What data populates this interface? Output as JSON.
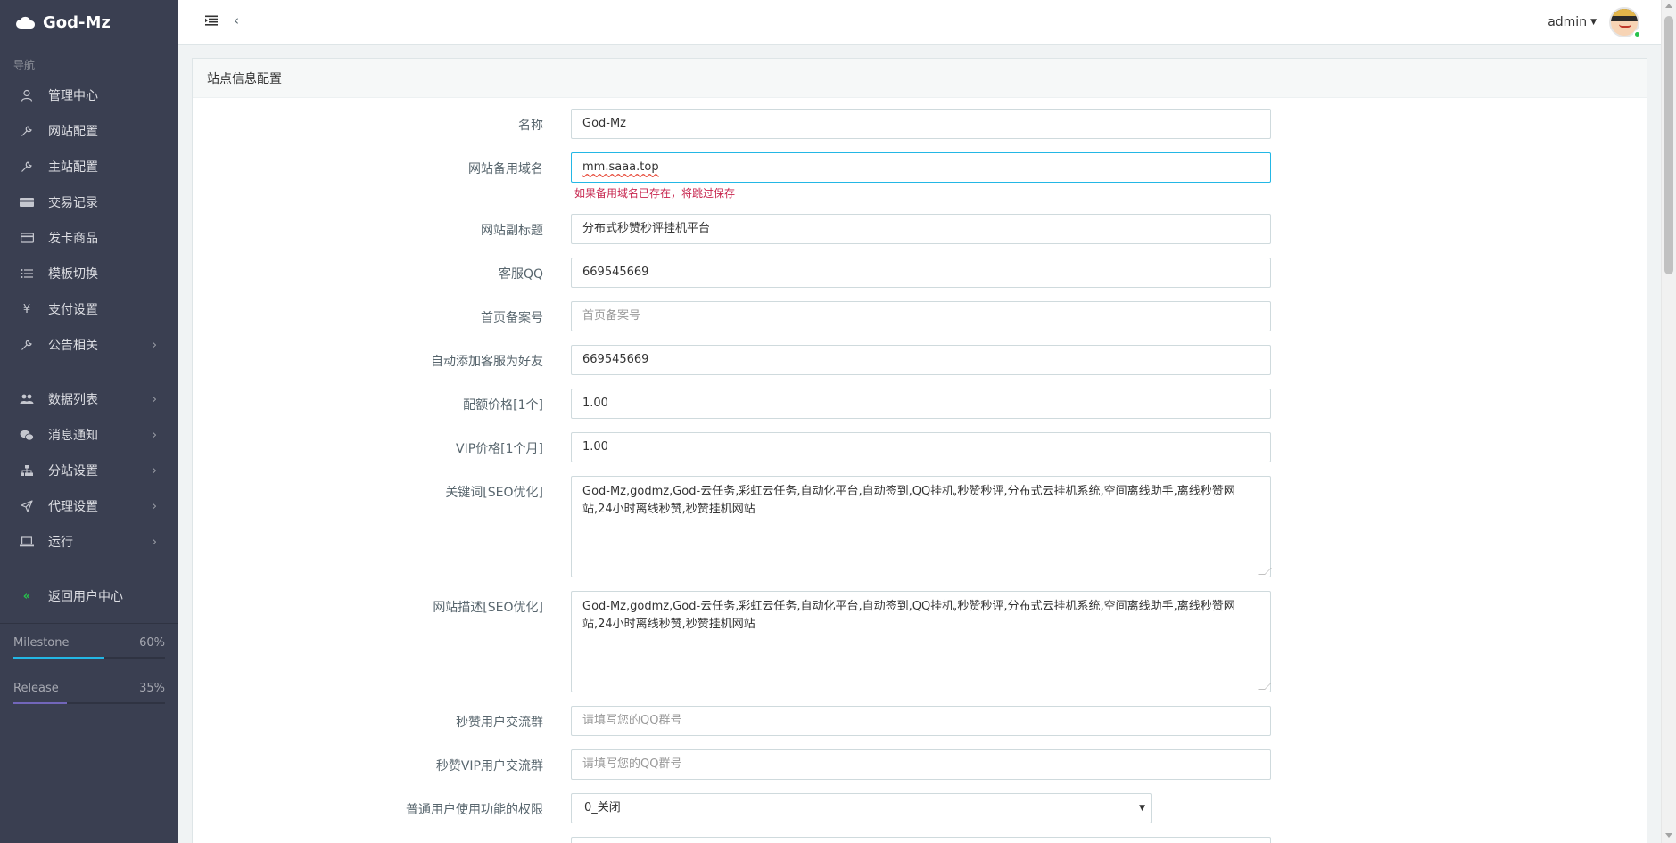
{
  "sidebar": {
    "brand": "God-Mz",
    "nav_header": "导航",
    "items": [
      {
        "label": "管理中心",
        "icon": "user-icon",
        "has_sub": false
      },
      {
        "label": "网站配置",
        "icon": "wrench-icon",
        "has_sub": false
      },
      {
        "label": "主站配置",
        "icon": "wrench-icon",
        "has_sub": false
      },
      {
        "label": "交易记录",
        "icon": "credit-card-icon",
        "has_sub": false
      },
      {
        "label": "发卡商品",
        "icon": "card-icon",
        "has_sub": false
      },
      {
        "label": "模板切换",
        "icon": "list-icon",
        "has_sub": false
      },
      {
        "label": "支付设置",
        "icon": "yen-icon",
        "has_sub": false
      },
      {
        "label": "公告相关",
        "icon": "wrench-icon",
        "has_sub": true
      }
    ],
    "items2": [
      {
        "label": "数据列表",
        "icon": "users-icon",
        "has_sub": true
      },
      {
        "label": "消息通知",
        "icon": "wechat-icon",
        "has_sub": true
      },
      {
        "label": "分站设置",
        "icon": "sitemap-icon",
        "has_sub": true
      },
      {
        "label": "代理设置",
        "icon": "send-icon",
        "has_sub": true
      },
      {
        "label": "运行",
        "icon": "laptop-icon",
        "has_sub": true
      }
    ],
    "back_label": "返回用户中心",
    "progress": [
      {
        "label": "Milestone",
        "value_text": "60%",
        "value": 60,
        "color": "#23b7e5"
      },
      {
        "label": "Release",
        "value_text": "35%",
        "value": 35,
        "color": "#7266ba"
      }
    ]
  },
  "header": {
    "username": "admin"
  },
  "panel": {
    "title": "站点信息配置",
    "fields": {
      "name": {
        "label": "名称",
        "value": "God-Mz"
      },
      "backup_domain": {
        "label": "网站备用域名",
        "value": "mm.saaa.top",
        "help": "如果备用域名已存在，将跳过保存"
      },
      "subtitle": {
        "label": "网站副标题",
        "value": "分布式秒赞秒评挂机平台"
      },
      "service_qq": {
        "label": "客服QQ",
        "value": "669545669"
      },
      "icp": {
        "label": "首页备案号",
        "placeholder": "首页备案号"
      },
      "auto_add_friend": {
        "label": "自动添加客服为好友",
        "value": "669545669"
      },
      "quota_price": {
        "label": "配额价格[1个]",
        "value": "1.00"
      },
      "vip_price": {
        "label": "VIP价格[1个月]",
        "value": "1.00"
      },
      "keywords": {
        "label": "关键词[SEO优化]",
        "line1": "God-Mz,godmz,God-云任务,彩虹云任务,自动化平台,自动签到,QQ挂机,秒赞秒评,分布式云挂机系统,空间离线助手,离线秒赞网",
        "line2": "站,24小时离线秒赞,秒赞挂机网站"
      },
      "description": {
        "label": "网站描述[SEO优化]",
        "line1": "God-Mz,godmz,God-云任务,彩虹云任务,自动化平台,自动签到,QQ挂机,秒赞秒评,分布式云挂机系统,空间离线助手,离线秒赞网",
        "line2": "站,24小时离线秒赞,秒赞挂机网站"
      },
      "user_group": {
        "label": "秒赞用户交流群",
        "placeholder": "请填写您的QQ群号"
      },
      "vip_group": {
        "label": "秒赞VIP用户交流群",
        "placeholder": "请填写您的QQ群号"
      },
      "user_permission": {
        "label": "普通用户使用功能的权限",
        "selected": "0_关闭"
      }
    }
  }
}
